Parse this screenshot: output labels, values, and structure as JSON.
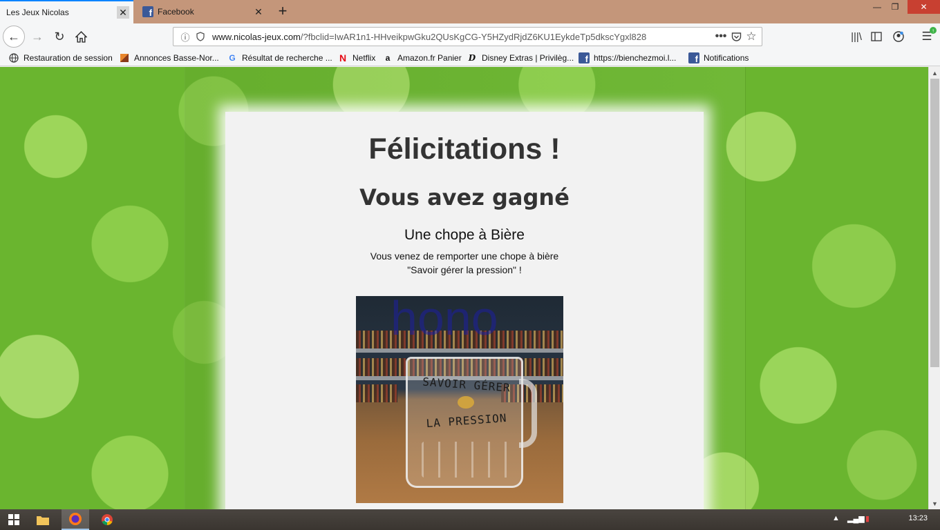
{
  "browser": {
    "tabs": [
      {
        "title": "Les Jeux Nicolas",
        "active": true
      },
      {
        "title": "Facebook",
        "active": false
      }
    ],
    "url": {
      "domain": "www.nicolas-jeux.com",
      "path": "/?fbclid=IwAR1n1-HHveikpwGku2QUsKgCG-Y5HZydRjdZ6KU1EykdeTp5dkscYgxl828"
    },
    "bookmarks": [
      {
        "label": "Restauration de session",
        "icon": "globe-icon"
      },
      {
        "label": "Annonces Basse-Nor...",
        "icon": "annonces-icon"
      },
      {
        "label": "Résultat de recherche ...",
        "icon": "google-icon"
      },
      {
        "label": "Netflix",
        "icon": "netflix-icon"
      },
      {
        "label": "Amazon.fr Panier",
        "icon": "amazon-icon"
      },
      {
        "label": "Disney Extras | Privilèg...",
        "icon": "disney-icon"
      },
      {
        "label": "https://bienchezmoi.l...",
        "icon": "facebook-icon"
      },
      {
        "label": "Notifications",
        "icon": "facebook-icon"
      }
    ]
  },
  "page": {
    "heading": "Félicitations !",
    "subheading": "Vous avez gagné",
    "prize_name": "Une chope à Bière",
    "description_line1": "Vous venez de remporter une chope à bière",
    "description_line2": "\"Savoir gérer la pression\" !",
    "image_overlay_text": "hono",
    "mug_text_line1": "SAVOIR GÉRER",
    "mug_text_line2": "LA PRESSION"
  },
  "taskbar": {
    "clock": "13:23"
  },
  "colors": {
    "tab_active_accent": "#0a84ff",
    "tabbar_bg": "#c4967a",
    "heading": "#333333",
    "card_bg": "#f2f2f2"
  }
}
